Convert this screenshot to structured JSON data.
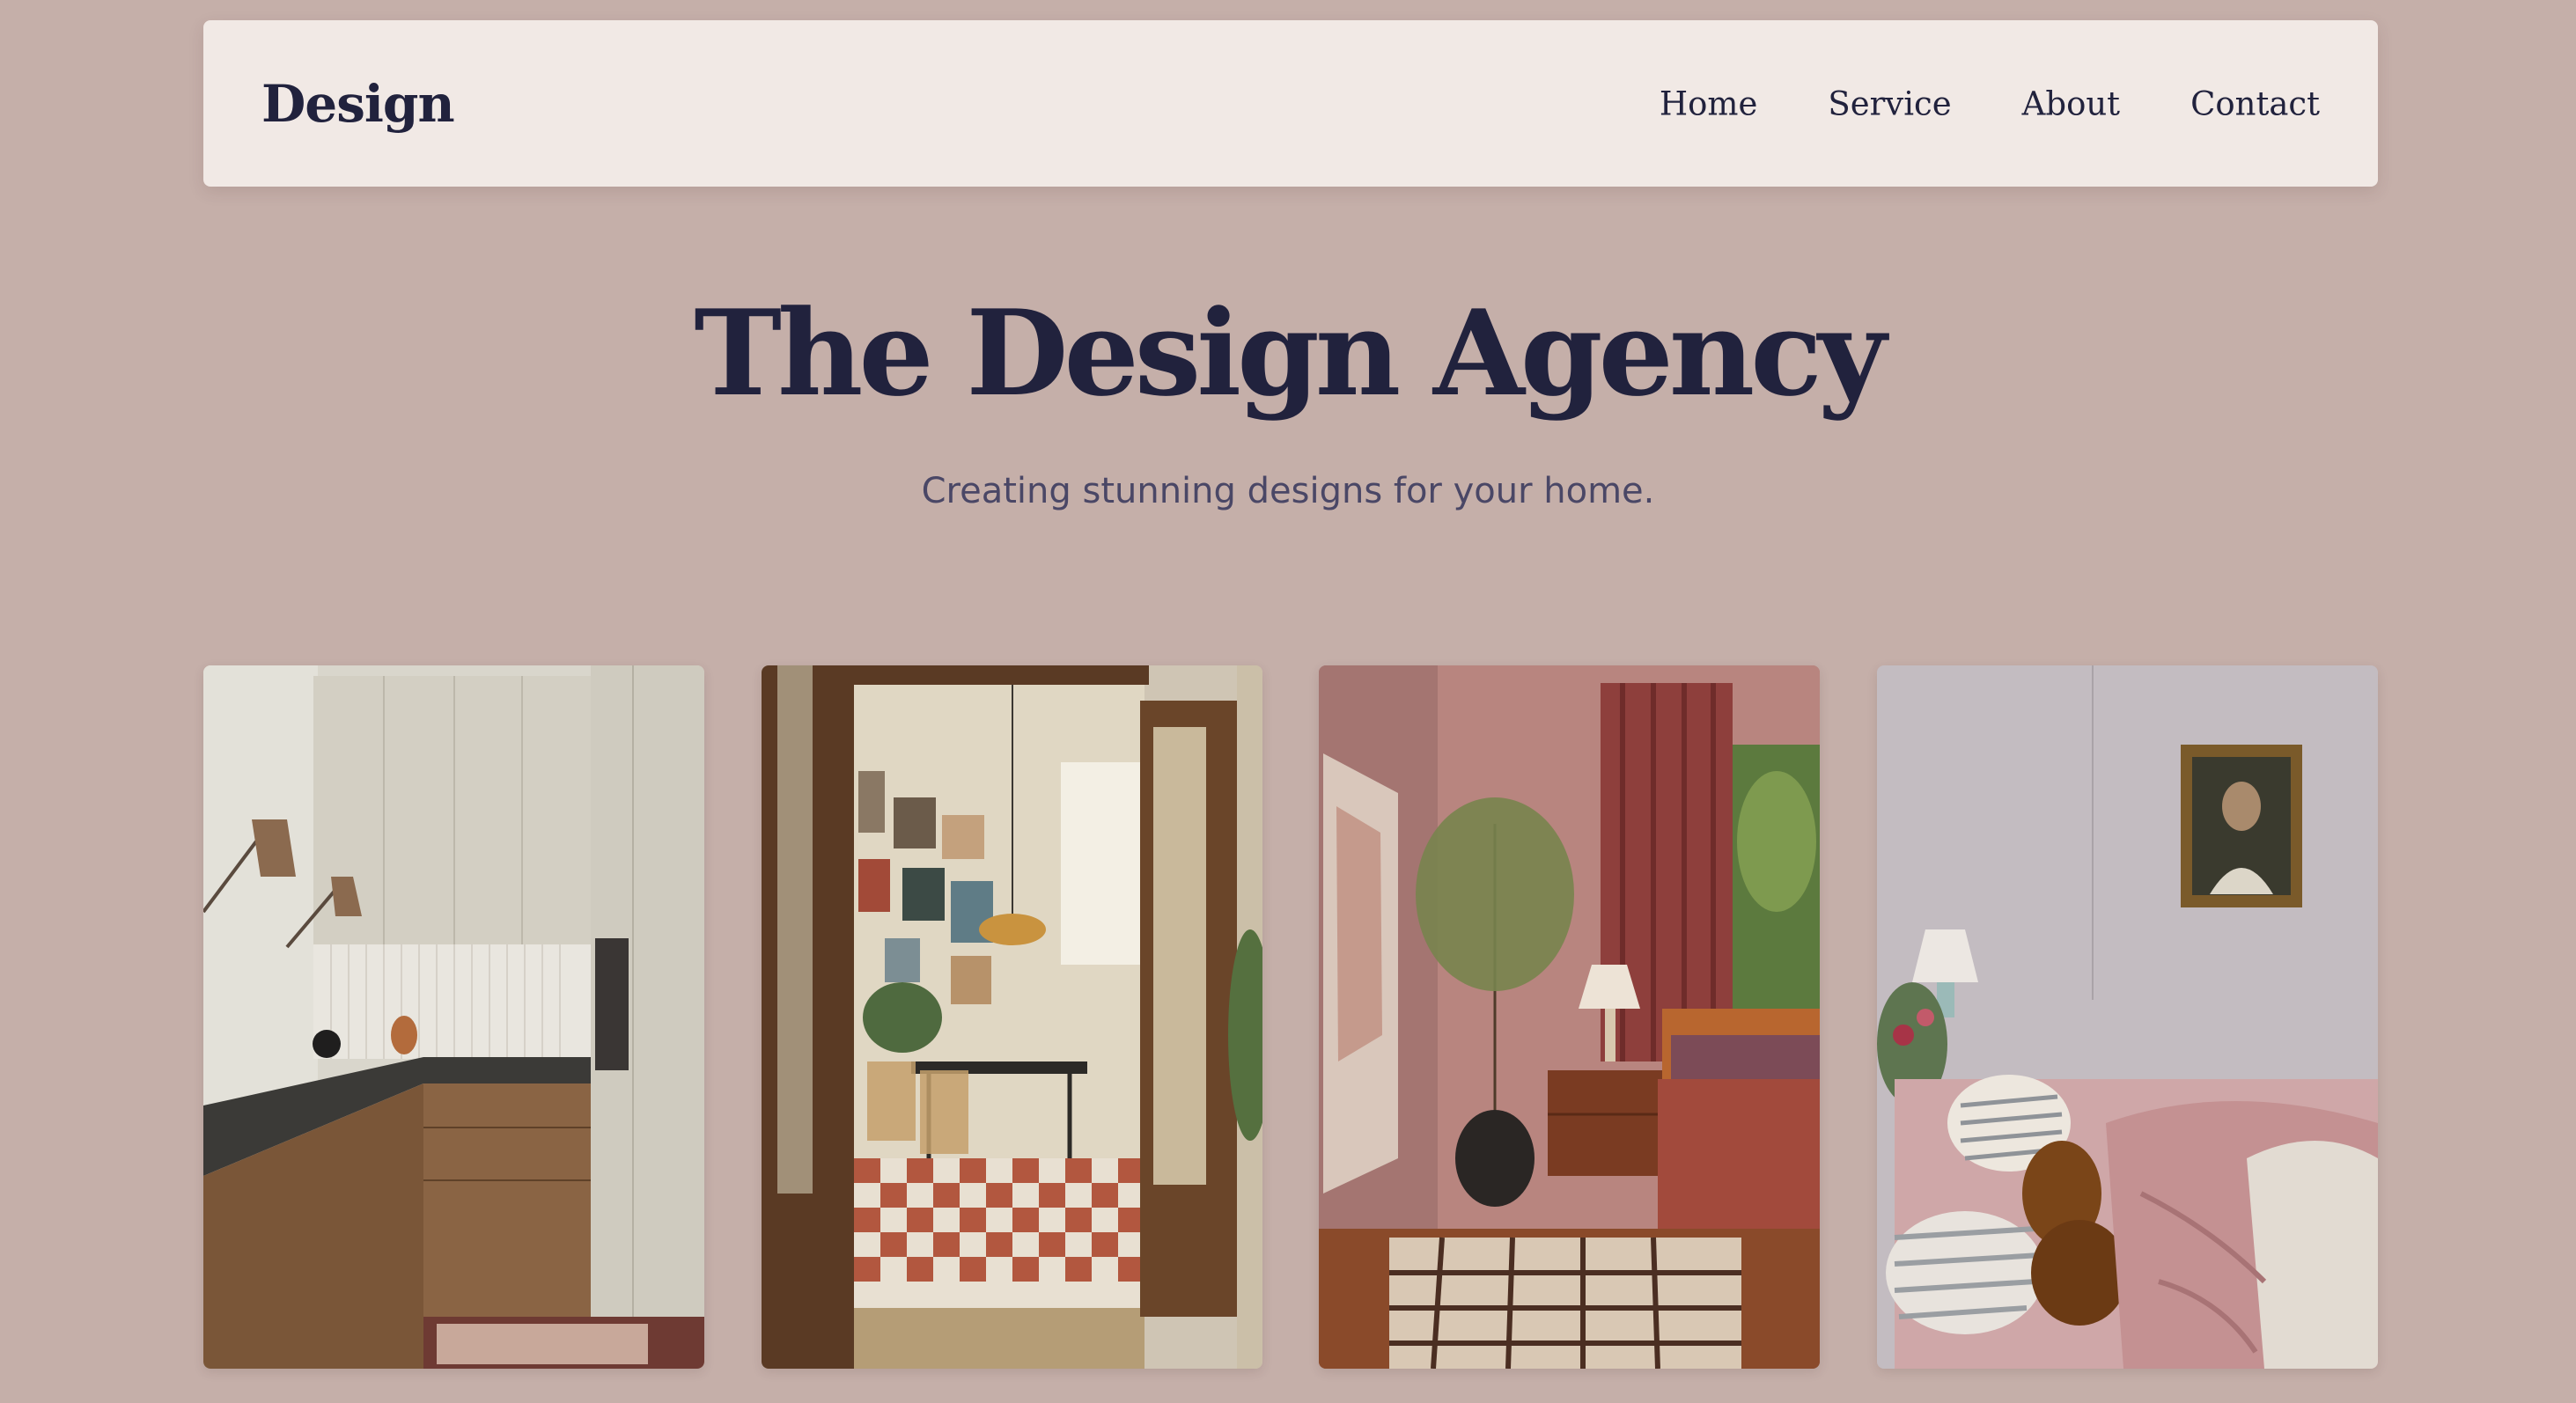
{
  "nav": {
    "brand": "Design",
    "links": [
      "Home",
      "Service",
      "About",
      "Contact"
    ]
  },
  "hero": {
    "title": "The Design Agency",
    "subtitle": "Creating stunning designs for your home."
  },
  "gallery": {
    "images": [
      {
        "subject": "kitchen"
      },
      {
        "subject": "dining room through doorway"
      },
      {
        "subject": "pink bedroom with curtains"
      },
      {
        "subject": "bedroom with portrait"
      }
    ]
  },
  "colors": {
    "background": "#c5afa9",
    "navbar": "#f1e9e5",
    "text_primary": "#21223d",
    "text_secondary": "#4a4766"
  }
}
